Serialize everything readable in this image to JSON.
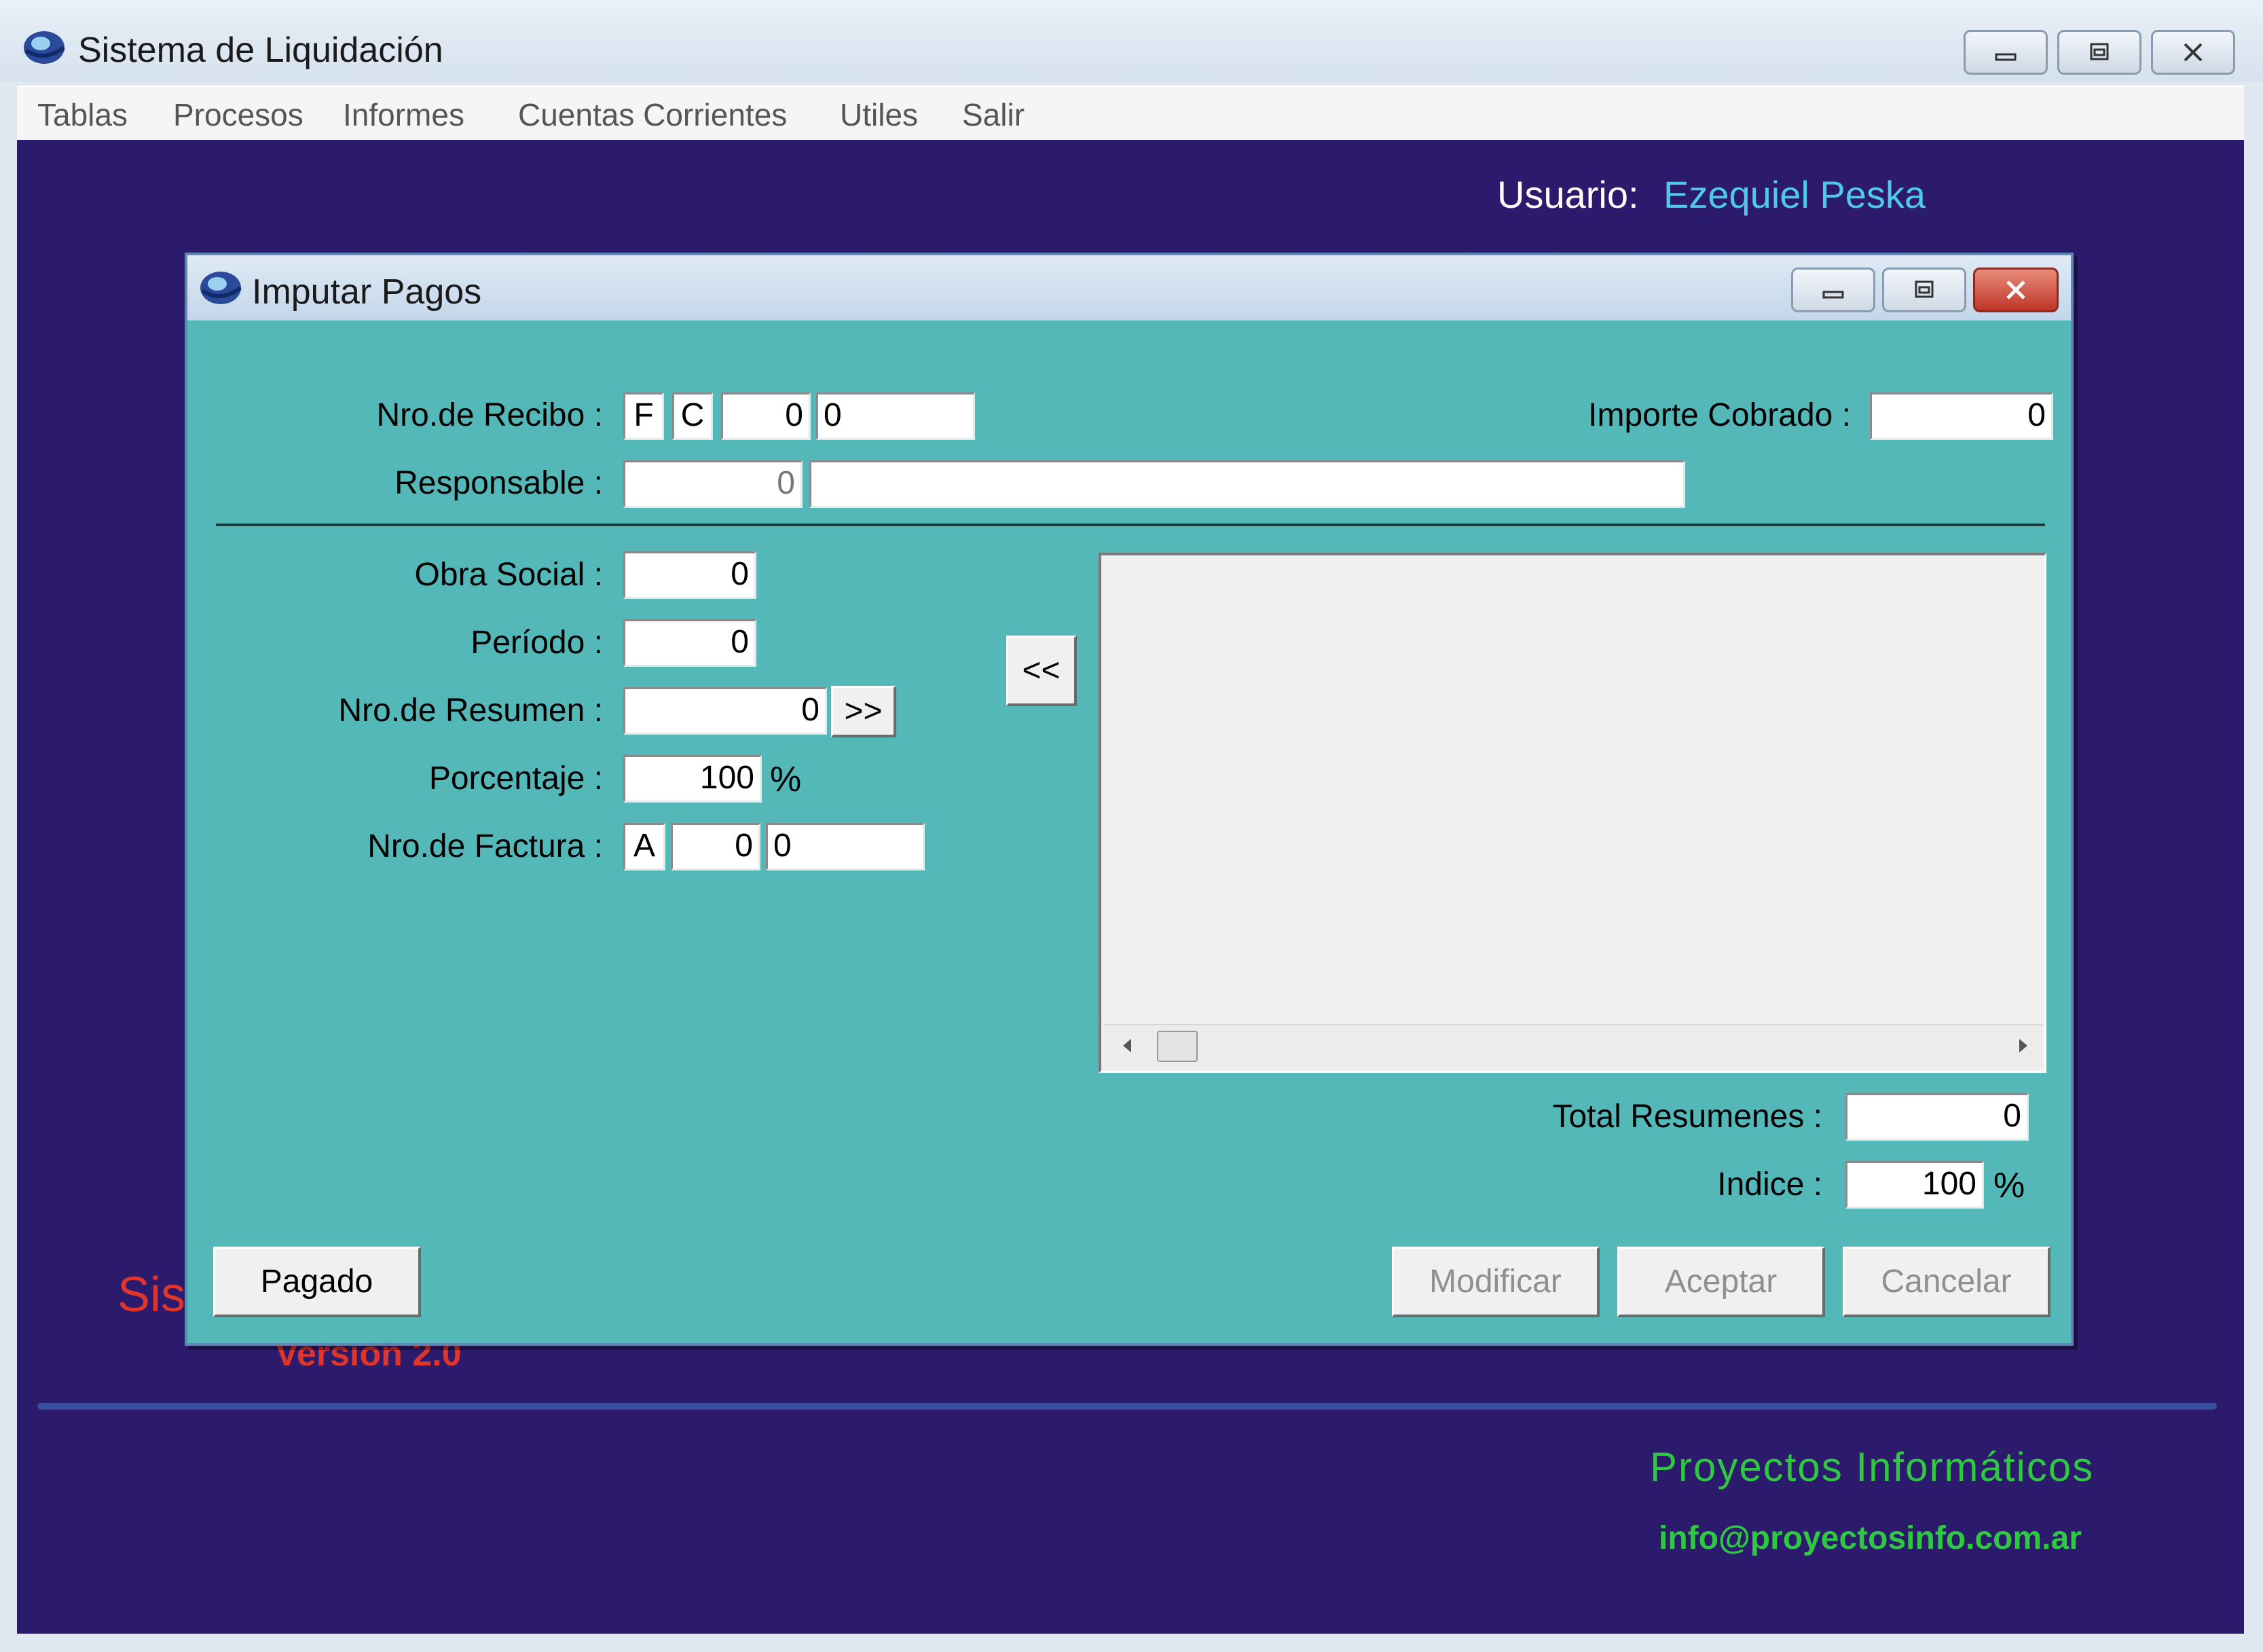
{
  "window": {
    "title": "Sistema de Liquidación"
  },
  "menubar": {
    "items": [
      "Tablas",
      "Procesos",
      "Informes",
      "Cuentas Corrientes",
      "Utiles",
      "Salir"
    ]
  },
  "client": {
    "user_label": "Usuario:",
    "user_name": "Ezequiel Peska",
    "splash_title_fragment": "Sis",
    "splash_version": "Version 2.0",
    "company_name": "Proyectos Informáticos",
    "company_email": "info@proyectosinfo.com.ar"
  },
  "dialog": {
    "title": "Imputar Pagos",
    "recibo": {
      "label": "Nro.de Recibo :",
      "letter": "F",
      "type": "C",
      "punto": "0",
      "numero": "0"
    },
    "importe_cobrado": {
      "label": "Importe Cobrado :",
      "value": "0"
    },
    "responsable": {
      "label": "Responsable :",
      "code": "0",
      "name": ""
    },
    "obra_social": {
      "label": "Obra Social :",
      "value": "0"
    },
    "periodo": {
      "label": "Período :",
      "value": "0"
    },
    "resumen": {
      "label": "Nro.de Resumen :",
      "value": "0",
      "add_button": ">>"
    },
    "porcentaje": {
      "label": "Porcentaje :",
      "value": "100",
      "unit": "%"
    },
    "factura": {
      "label": "Nro.de Factura :",
      "letter": "A",
      "punto": "0",
      "numero": "0"
    },
    "remove_button": "<<",
    "total_resumenes": {
      "label": "Total Resumenes :",
      "value": "0"
    },
    "indice": {
      "label": "Indice :",
      "value": "100",
      "unit": "%"
    },
    "buttons": {
      "pagado": "Pagado",
      "modificar": "Modificar",
      "aceptar": "Aceptar",
      "cancelar": "Cancelar"
    }
  },
  "colors": {
    "desktop_background": "#2c1a6c",
    "dialog_background": "#55b8b8",
    "user_name": "#4ec9e6",
    "splash_red": "#e0352a",
    "company_green": "#2ec940"
  }
}
